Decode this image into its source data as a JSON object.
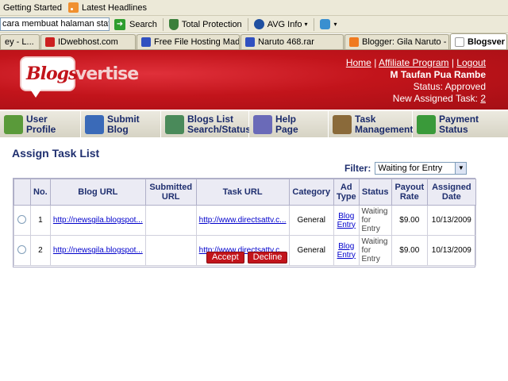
{
  "bookmarks": {
    "items": [
      {
        "label": "Getting Started",
        "icon": "page-icon"
      },
      {
        "label": "Latest Headlines",
        "icon": "rss-icon"
      }
    ]
  },
  "toolbar": {
    "search_value": "cara membuat halaman statis",
    "search_label": "Search",
    "protection_label": "Total Protection",
    "avg_label": "AVG Info",
    "avg_arrow": "▾",
    "ie_arrow": "▾"
  },
  "tabs": [
    {
      "label": "ey - L...",
      "color": "#5e6fa8",
      "active": false
    },
    {
      "label": "IDwebhost.com",
      "color": "#cc2020",
      "active": false
    },
    {
      "label": "Free File Hosting Mad...",
      "color": "#3050c0",
      "active": false
    },
    {
      "label": "Naruto 468.rar",
      "color": "#3050c0",
      "active": false
    },
    {
      "label": "Blogger: Gila Naruto - ...",
      "color": "#f07a20",
      "active": false
    },
    {
      "label": "Blogsver",
      "color": "#ffffff",
      "active": true
    }
  ],
  "header": {
    "logo_part1": "Blogs",
    "logo_part2": "vertise",
    "links": [
      "Home",
      "Affiliate Program",
      "Logout"
    ],
    "link_sep": "|",
    "user_name": "M Taufan Pua Rambe",
    "status_label": "Status: Approved",
    "assigned_label": "New Assigned Task:",
    "assigned_count": "2"
  },
  "nav": [
    {
      "label_line1": "User",
      "label_line2": "Profile",
      "icon": "user-profile-icon",
      "color": "#5a9a3a"
    },
    {
      "label_line1": "Submit",
      "label_line2": "Blog",
      "icon": "submit-blog-icon",
      "color": "#3a6ab8"
    },
    {
      "label_line1": "Blogs List",
      "label_line2": "Search/Status",
      "icon": "blogs-list-icon",
      "color": "#4a8a5a"
    },
    {
      "label_line1": "Help",
      "label_line2": "Page",
      "icon": "help-icon",
      "color": "#6a6ab8"
    },
    {
      "label_line1": "Task",
      "label_line2": "Management",
      "icon": "task-management-icon",
      "color": "#8a6a3a"
    },
    {
      "label_line1": "Payment",
      "label_line2": "Status",
      "icon": "payment-status-icon",
      "color": "#3a9a3a"
    }
  ],
  "page": {
    "title": "Assign Task List",
    "filter_label": "Filter:",
    "filter_value": "Waiting for Entry"
  },
  "table": {
    "headers": [
      "",
      "No.",
      "Blog URL",
      "Submitted URL",
      "Task URL",
      "Category",
      "Ad Type",
      "Status",
      "Payout Rate",
      "Assigned Date"
    ],
    "rows": [
      {
        "no": "1",
        "blog_url": "http://newsgila.blogspot...",
        "submitted_url": "",
        "task_url": "http://www.directsattv.c...",
        "category": "General",
        "ad_type_1": "Blog",
        "ad_type_2": "Entry",
        "status_1": "Waiting",
        "status_2": "for Entry",
        "payout": "$9.00",
        "date": "10/13/2009"
      },
      {
        "no": "2",
        "blog_url": "http://newsgila.blogspot...",
        "submitted_url": "",
        "task_url": "http://www.directsattv.c...",
        "category": "General",
        "ad_type_1": "Blog",
        "ad_type_2": "Entry",
        "status_1": "Waiting",
        "status_2": "for Entry",
        "payout": "$9.00",
        "date": "10/13/2009"
      }
    ]
  },
  "actions": {
    "accept": "Accept",
    "decline": "Decline"
  }
}
